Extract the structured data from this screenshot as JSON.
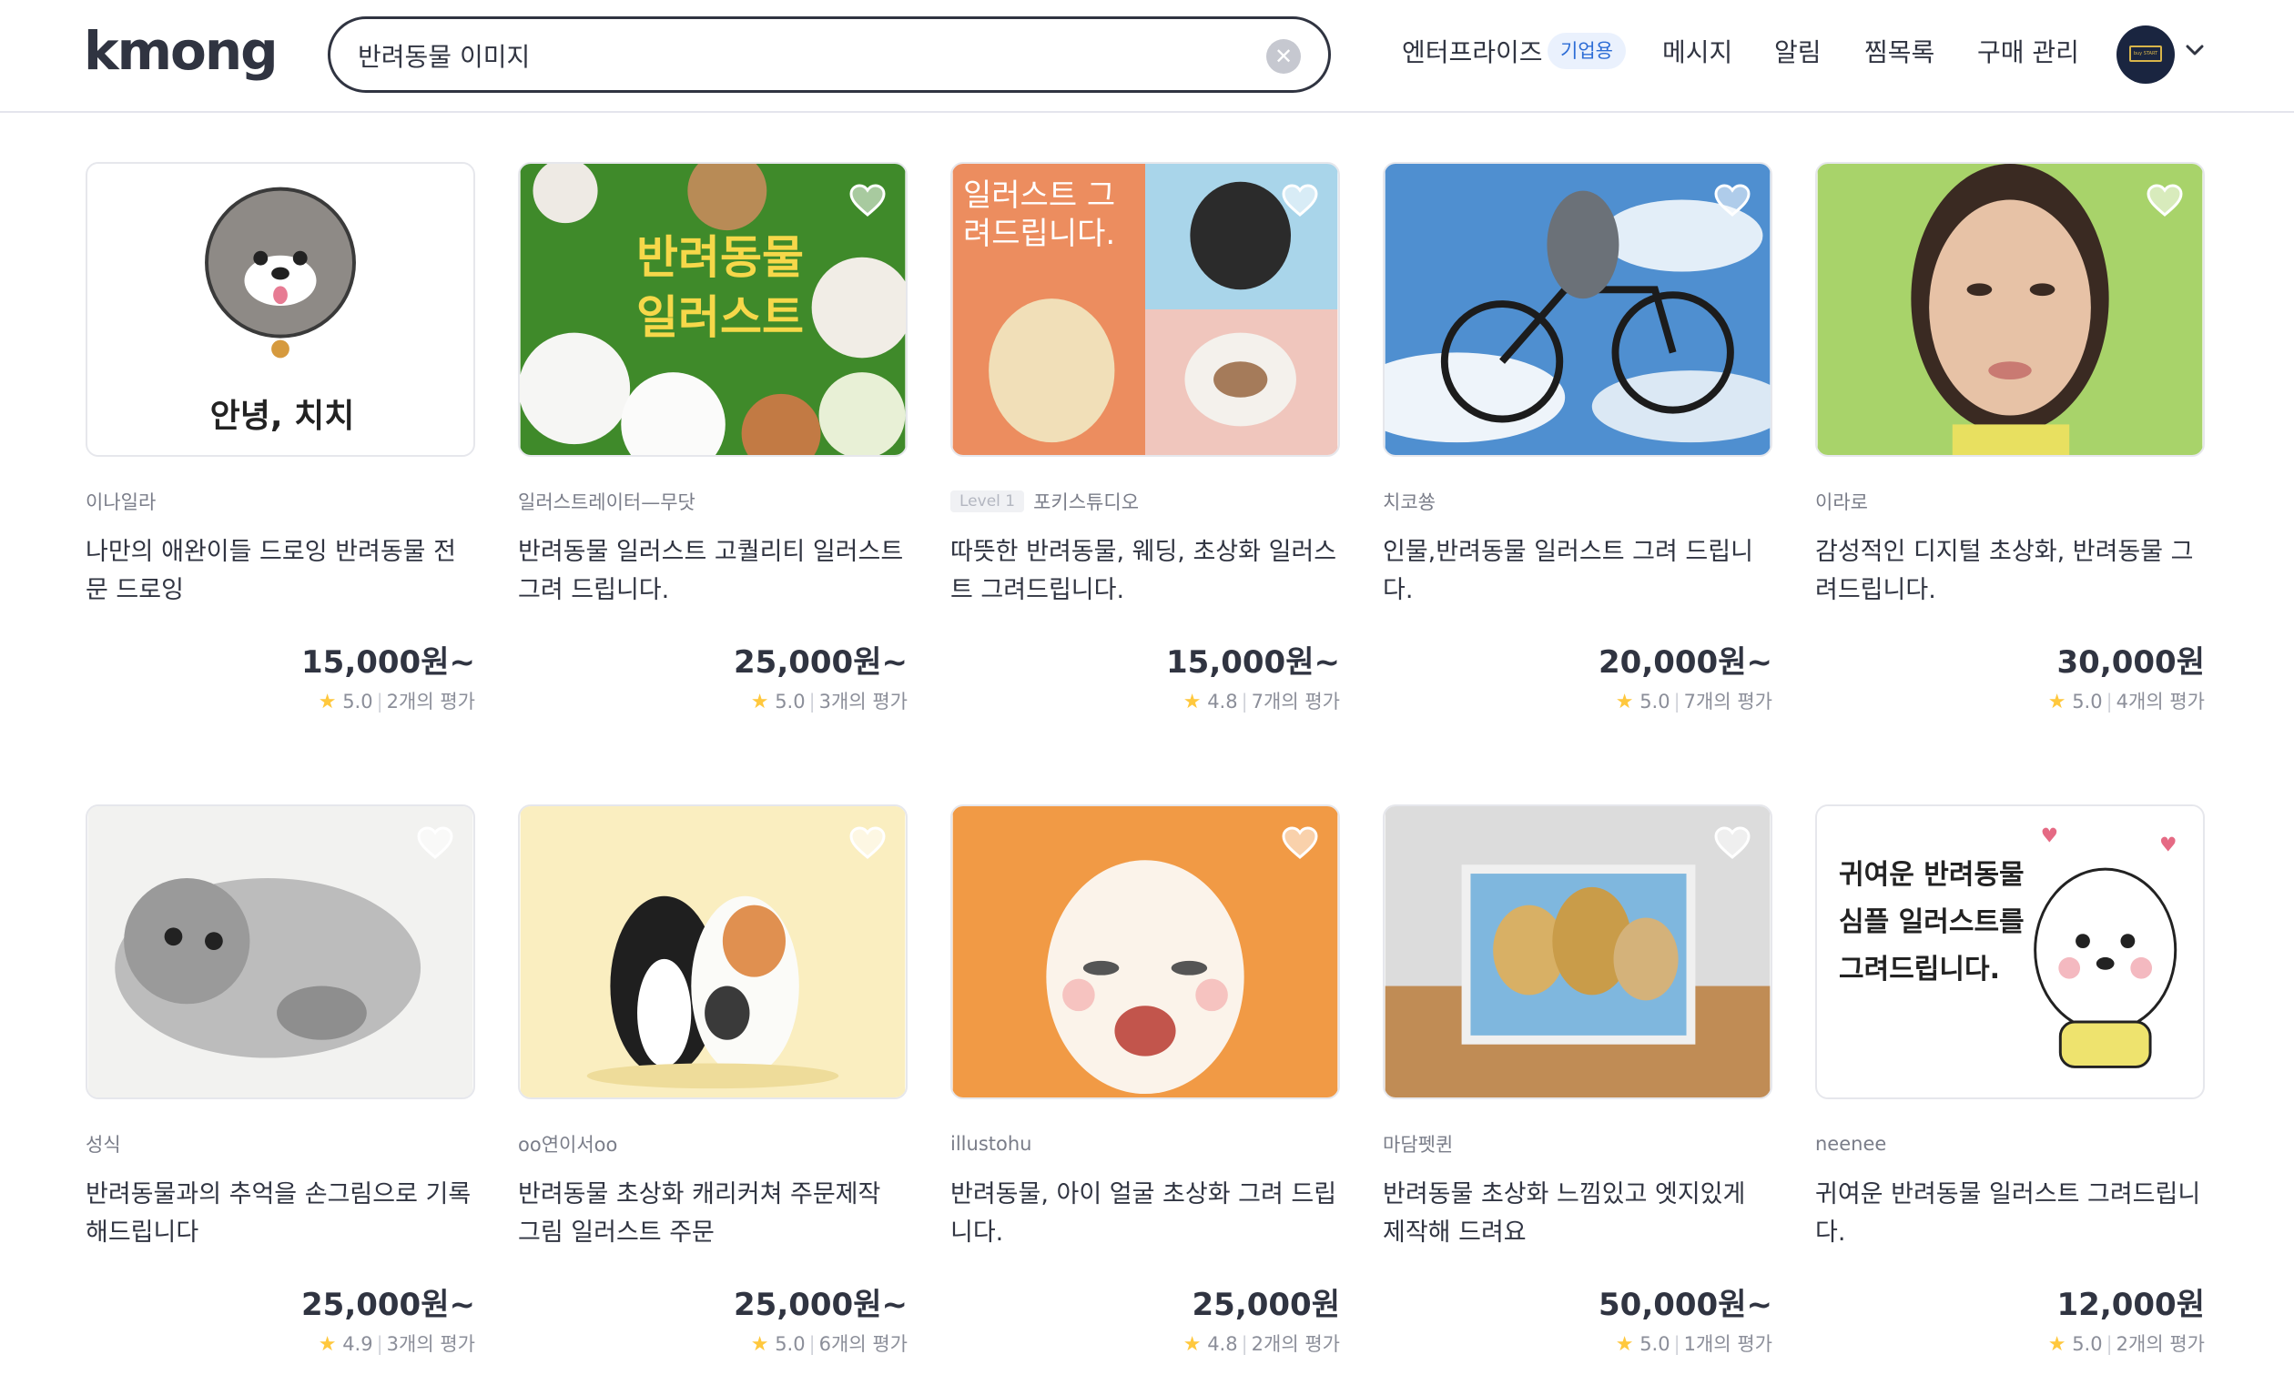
{
  "header": {
    "logo": "kmong",
    "search_value": "반려동물 이미지",
    "nav_enterprise": "엔터프라이즈",
    "nav_enterprise_badge": "기업용",
    "nav_messages": "메시지",
    "nav_alerts": "알림",
    "nav_favorites": "찜목록",
    "nav_purchases": "구매 관리",
    "avatar_text": "buy START"
  },
  "cards": [
    {
      "seller": "이나일라",
      "level": "",
      "title": "나만의 애완이들 드로잉 반려동물 전문 드로잉",
      "price": "15,000원~",
      "rating": "5.0",
      "reviews": "2개의 평가",
      "thumb_text": "안녕, 치치"
    },
    {
      "seller": "일러스트레이터—무닷",
      "level": "",
      "title": "반려동물 일러스트 고퀄리티 일러스트 그려 드립니다.",
      "price": "25,000원~",
      "rating": "5.0",
      "reviews": "3개의 평가",
      "thumb_text": "반려동물 일러스트"
    },
    {
      "seller": "포키스튜디오",
      "level": "Level 1",
      "title": "따뜻한 반려동물, 웨딩, 초상화 일러스트 그려드립니다.",
      "price": "15,000원~",
      "rating": "4.8",
      "reviews": "7개의 평가",
      "thumb_text": "일러스트 그려드립니다."
    },
    {
      "seller": "치코쑝",
      "level": "",
      "title": "인물,반려동물 일러스트 그려 드립니다.",
      "price": "20,000원~",
      "rating": "5.0",
      "reviews": "7개의 평가",
      "thumb_text": ""
    },
    {
      "seller": "이라로",
      "level": "",
      "title": "감성적인 디지털 초상화, 반려동물 그려드립니다.",
      "price": "30,000원",
      "rating": "5.0",
      "reviews": "4개의 평가",
      "thumb_text": ""
    },
    {
      "seller": "성식",
      "level": "",
      "title": "반려동물과의 추억을 손그림으로 기록해드립니다",
      "price": "25,000원~",
      "rating": "4.9",
      "reviews": "3개의 평가",
      "thumb_text": ""
    },
    {
      "seller": "oo연이서oo",
      "level": "",
      "title": "반려동물 초상화 캐리커쳐 주문제작 그림 일러스트 주문",
      "price": "25,000원~",
      "rating": "5.0",
      "reviews": "6개의 평가",
      "thumb_text": ""
    },
    {
      "seller": "illustohu",
      "level": "",
      "title": "반려동물, 아이 얼굴 초상화 그려 드립니다.",
      "price": "25,000원",
      "rating": "4.8",
      "reviews": "2개의 평가",
      "thumb_text": ""
    },
    {
      "seller": "마담펫퀸",
      "level": "",
      "title": "반려동물 초상화 느낌있고 엣지있게 제작해 드려요",
      "price": "50,000원~",
      "rating": "5.0",
      "reviews": "1개의 평가",
      "thumb_text": ""
    },
    {
      "seller": "neenee",
      "level": "",
      "title": "귀여운 반려동물 일러스트 그려드립니다.",
      "price": "12,000원",
      "rating": "5.0",
      "reviews": "2개의 평가",
      "thumb_text": "귀여운 반려동물 심플 일러스트를 그려드립니다."
    }
  ],
  "colors": {
    "accent_badge": "#2d6dd6",
    "star": "#ffc83d",
    "text": "#303441"
  }
}
